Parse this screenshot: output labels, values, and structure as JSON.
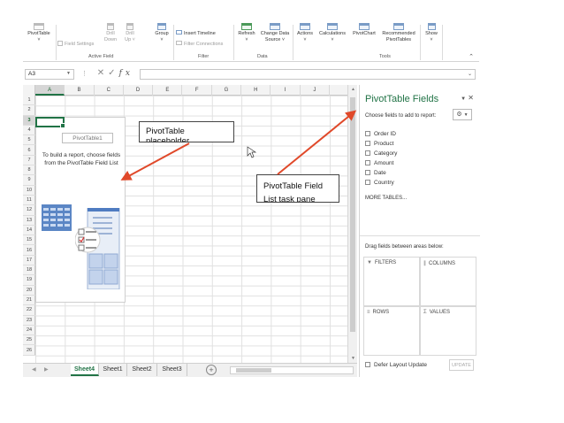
{
  "ribbon": {
    "pivottable": "PivotTable",
    "pivottable_dd": "˅",
    "field_settings": "Field Settings",
    "drill_down": "Drill",
    "drill_down2": "Down",
    "drill_up": "Drill",
    "drill_up2": "Up ˅",
    "group": "Group",
    "group_dd": "˅",
    "insert_timeline": "Insert Timeline",
    "filter_connections": "Filter Connections",
    "refresh": "Refresh",
    "refresh_dd": "˅",
    "change_source": "Change Data",
    "change_source2": "Source ˅",
    "change_source_dd": "˅",
    "actions": "Actions",
    "actions_dd": "˅",
    "calculations": "Calculations",
    "calculations_dd": "˅",
    "pivotchart": "PivotChart",
    "recommended": "Recommended",
    "recommended2": "PivotTables",
    "show": "Show",
    "show_dd": "˅",
    "groups": {
      "active_field": "Active Field",
      "filter": "Filter",
      "data": "Data",
      "tools": "Tools"
    }
  },
  "formula_bar": {
    "name_box": "A3",
    "formula": ""
  },
  "sheet": {
    "columns": [
      "A",
      "B",
      "C",
      "D",
      "E",
      "F",
      "G",
      "H",
      "I",
      "J"
    ],
    "rows": [
      "1",
      "2",
      "3",
      "4",
      "5",
      "6",
      "7",
      "8",
      "9",
      "10",
      "11",
      "12",
      "13",
      "14",
      "15",
      "16",
      "17",
      "18",
      "19",
      "20",
      "21",
      "22",
      "23",
      "24",
      "25",
      "26"
    ],
    "selected_cell": "A3"
  },
  "placeholder": {
    "name": "PivotTable1",
    "help": "To build a report, choose fields from the PivotTable Field List"
  },
  "tabs": [
    "Sheet4",
    "Sheet1",
    "Sheet2",
    "Sheet3"
  ],
  "active_tab": "Sheet4",
  "pane": {
    "title": "PivotTable Fields",
    "choose": "Choose fields to add to report:",
    "fields": [
      "Order ID",
      "Product",
      "Category",
      "Amount",
      "Date",
      "Country"
    ],
    "more_tables": "MORE TABLES...",
    "drag": "Drag fields between areas below:",
    "areas": {
      "filters": "FILTERS",
      "columns": "COLUMNS",
      "rows": "ROWS",
      "values": "VALUES"
    },
    "defer": "Defer Layout Update",
    "update": "UPDATE"
  },
  "callouts": {
    "placeholder": "PivotTable placeholder",
    "field_list": "PivotTable Field List task pane"
  },
  "colors": {
    "excel_green": "#217346",
    "arrow": "#e0492a"
  },
  "icons": {
    "checked": "checkmark-icon"
  }
}
